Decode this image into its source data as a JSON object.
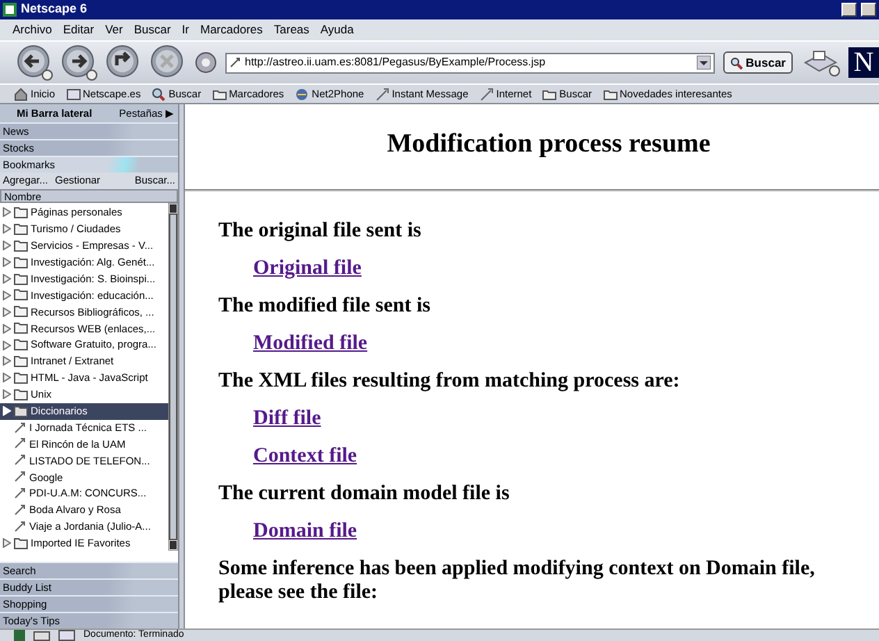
{
  "window": {
    "title": "Netscape 6"
  },
  "menu": [
    "Archivo",
    "Editar",
    "Ver",
    "Buscar",
    "Ir",
    "Marcadores",
    "Tareas",
    "Ayuda"
  ],
  "navigation": {
    "url": "http://astreo.ii.uam.es:8081/Pegasus/ByExample/Process.jsp",
    "search_button": "Buscar",
    "logo_text": "N"
  },
  "personal_toolbar": [
    {
      "label": "Inicio",
      "kind": "home"
    },
    {
      "label": "Netscape.es",
      "kind": "my"
    },
    {
      "label": "Buscar",
      "kind": "search"
    },
    {
      "label": "Marcadores",
      "kind": "folder"
    },
    {
      "label": "Net2Phone",
      "kind": "phone"
    },
    {
      "label": "Instant Message",
      "kind": "bookmark"
    },
    {
      "label": "Internet",
      "kind": "bookmark"
    },
    {
      "label": "Buscar",
      "kind": "folder"
    },
    {
      "label": "Novedades interesantes",
      "kind": "folder"
    }
  ],
  "sidebar": {
    "title": "Mi Barra lateral",
    "tabs_button": "Pestañas",
    "tabs_arrow": "▶",
    "panels_top": [
      {
        "label": "News",
        "selected": false
      },
      {
        "label": "Stocks",
        "selected": false
      },
      {
        "label": "Bookmarks",
        "selected": true
      }
    ],
    "bookmark_actions": [
      "Agregar...",
      "Gestionar",
      "Buscar..."
    ],
    "column": "Nombre",
    "tree": [
      {
        "label": "Páginas personales",
        "kind": "folder",
        "selected": false
      },
      {
        "label": "Turismo / Ciudades",
        "kind": "folder",
        "selected": false
      },
      {
        "label": "Servicios - Empresas - V...",
        "kind": "folder",
        "selected": false
      },
      {
        "label": "Investigación: Alg. Genét...",
        "kind": "folder",
        "selected": false
      },
      {
        "label": "Investigación: S. Bioinspi...",
        "kind": "folder",
        "selected": false
      },
      {
        "label": "Investigación: educación...",
        "kind": "folder",
        "selected": false
      },
      {
        "label": "Recursos Bibliográficos, ...",
        "kind": "folder",
        "selected": false
      },
      {
        "label": "Recursos WEB (enlaces,...",
        "kind": "folder",
        "selected": false
      },
      {
        "label": "Software Gratuito, progra...",
        "kind": "folder",
        "selected": false
      },
      {
        "label": "Intranet / Extranet",
        "kind": "folder",
        "selected": false
      },
      {
        "label": "HTML - Java - JavaScript",
        "kind": "folder",
        "selected": false
      },
      {
        "label": "Unix",
        "kind": "folder",
        "selected": false
      },
      {
        "label": "Diccionarios",
        "kind": "folder",
        "selected": true
      },
      {
        "label": "I Jornada Técnica ETS ...",
        "kind": "bookmark",
        "selected": false
      },
      {
        "label": "El Rincón de la UAM",
        "kind": "bookmark",
        "selected": false
      },
      {
        "label": "LISTADO DE TELEFON...",
        "kind": "bookmark",
        "selected": false
      },
      {
        "label": "Google",
        "kind": "bookmark",
        "selected": false
      },
      {
        "label": "PDI-U.A.M: CONCURS...",
        "kind": "bookmark",
        "selected": false
      },
      {
        "label": "Boda Alvaro y Rosa",
        "kind": "bookmark",
        "selected": false
      },
      {
        "label": "Viaje a Jordania (Julio-A...",
        "kind": "bookmark",
        "selected": false
      },
      {
        "label": "Imported IE Favorites",
        "kind": "folder",
        "selected": false
      }
    ],
    "panels_bottom": [
      {
        "label": "Search",
        "selected": false
      },
      {
        "label": "Buddy List",
        "selected": false
      },
      {
        "label": "Shopping",
        "selected": false
      },
      {
        "label": "Today's Tips",
        "selected": false
      }
    ]
  },
  "content": {
    "heading": "Modification process resume",
    "blocks": [
      {
        "kind": "text",
        "text": "The original file sent is"
      },
      {
        "kind": "link",
        "text": "Original file"
      },
      {
        "kind": "text",
        "text": "The modified file sent is"
      },
      {
        "kind": "link",
        "text": "Modified file"
      },
      {
        "kind": "text",
        "text": "The XML files resulting from matching process are:"
      },
      {
        "kind": "link",
        "text": "Diff file"
      },
      {
        "kind": "link",
        "text": "Context file"
      },
      {
        "kind": "text",
        "text": "The current domain model file is"
      },
      {
        "kind": "link",
        "text": "Domain file"
      },
      {
        "kind": "text",
        "text": "Some inference has been applied modifying context on Domain file, please see the file:"
      }
    ]
  },
  "status_bar": {
    "text": "Documento: Terminado"
  }
}
